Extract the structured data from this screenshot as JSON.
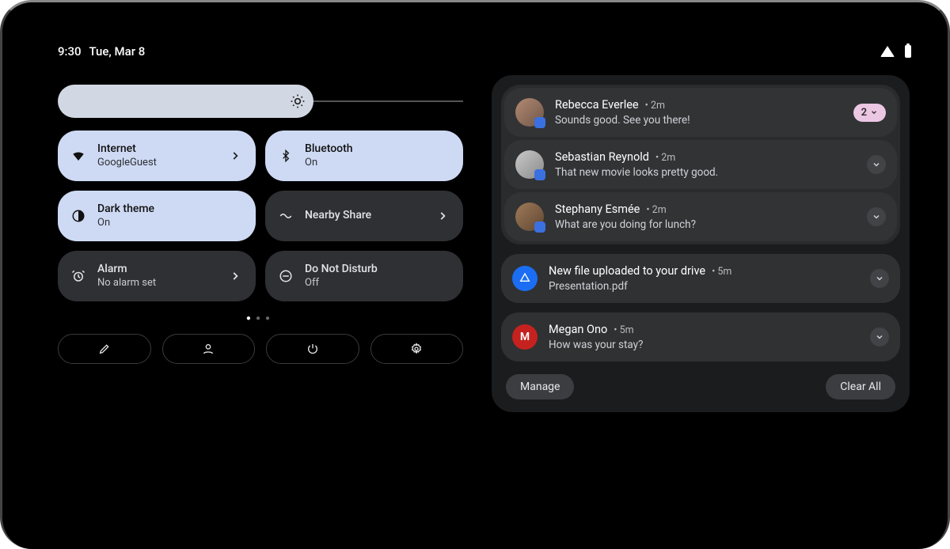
{
  "status": {
    "time": "9:30",
    "date": "Tue, Mar 8"
  },
  "brightness": {
    "percent": 63
  },
  "tiles": {
    "internet": {
      "title": "Internet",
      "sub": "GoogleGuest"
    },
    "bluetooth": {
      "title": "Bluetooth",
      "sub": "On"
    },
    "darktheme": {
      "title": "Dark theme",
      "sub": "On"
    },
    "nearby": {
      "title": "Nearby Share",
      "sub": ""
    },
    "alarm": {
      "title": "Alarm",
      "sub": "No alarm set"
    },
    "dnd": {
      "title": "Do Not Disturb",
      "sub": "Off"
    }
  },
  "pager": {
    "pages": 3,
    "current": 1
  },
  "notifications": {
    "group_count": "2",
    "items": [
      {
        "name": "Rebecca Everlee",
        "meta": "2m",
        "msg": "Sounds good. See you there!"
      },
      {
        "name": "Sebastian Reynold",
        "meta": "2m",
        "msg": "That new movie looks pretty good."
      },
      {
        "name": "Stephany Esmée",
        "meta": "2m",
        "msg": "What are you doing for lunch?"
      }
    ],
    "drive": {
      "title": "New file uploaded to your drive",
      "meta": "5m",
      "msg": "Presentation.pdf"
    },
    "gmail": {
      "name": "Megan Ono",
      "meta": "5m",
      "msg": "How was your stay?"
    },
    "manage": "Manage",
    "clear": "Clear All"
  }
}
